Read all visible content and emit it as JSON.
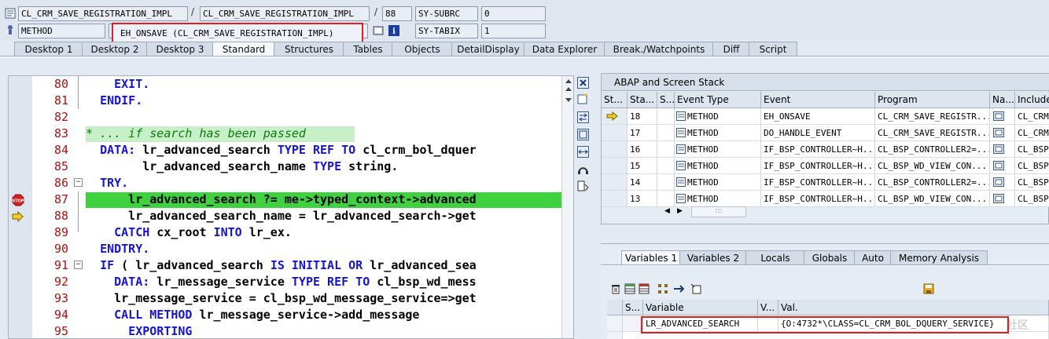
{
  "header": {
    "row1": {
      "program": "CL_CRM_SAVE_REGISTRATION_IMPL",
      "include": "CL_CRM_SAVE_REGISTRATION_IMPL",
      "line": "88",
      "sysfield_label": "SY-SUBRC",
      "sysfield_value": "0"
    },
    "row2": {
      "event_type": "METHOD",
      "event": "EH_ONSAVE (CL_CRM_SAVE_REGISTRATION_IMPL)",
      "sysfield_label": "SY-TABIX",
      "sysfield_value": "1"
    },
    "sep1": "/",
    "sep2": "/"
  },
  "tabs": [
    "Desktop 1",
    "Desktop 2",
    "Desktop 3",
    "Standard",
    "Structures",
    "Tables",
    "Objects",
    "DetailDisplay",
    "Data Explorer",
    "Break./Watchpoints",
    "Diff",
    "Script"
  ],
  "active_tab": "Standard",
  "code_lines": [
    {
      "no": "80",
      "code": "    EXIT."
    },
    {
      "no": "81",
      "code": "  ENDIF."
    },
    {
      "no": "82",
      "code": ""
    },
    {
      "no": "83",
      "code": "* ... if search has been passed"
    },
    {
      "no": "84",
      "code": "  DATA: lr_advanced_search TYPE REF TO cl_crm_bol_dquer"
    },
    {
      "no": "85",
      "code": "        lr_advanced_search_name TYPE string."
    },
    {
      "no": "86",
      "code": "  TRY."
    },
    {
      "no": "87",
      "code": "      lr_advanced_search ?= me->typed_context->advanced"
    },
    {
      "no": "88",
      "code": "      lr_advanced_search_name = lr_advanced_search->get"
    },
    {
      "no": "89",
      "code": "    CATCH cx_root INTO lr_ex."
    },
    {
      "no": "90",
      "code": "  ENDTRY."
    },
    {
      "no": "91",
      "code": "  IF ( lr_advanced_search IS INITIAL OR lr_advanced_sea"
    },
    {
      "no": "92",
      "code": "    DATA: lr_message_service TYPE REF TO cl_bsp_wd_mess"
    },
    {
      "no": "93",
      "code": "    lr_message_service = cl_bsp_wd_message_service=>get"
    },
    {
      "no": "94",
      "code": "    CALL METHOD lr_message_service->add_message"
    },
    {
      "no": "95",
      "code": "      EXPORTING"
    }
  ],
  "stack": {
    "title": "ABAP and Screen Stack",
    "columns": [
      "St...",
      "Sta...",
      "S...",
      "Event Type",
      "Event",
      "Program",
      "Na...",
      "Include"
    ],
    "rows": [
      {
        "level": "18",
        "type": "METHOD",
        "event": "EH_ONSAVE",
        "program": "CL_CRM_SAVE_REGISTR...",
        "include": "CL_CRM"
      },
      {
        "level": "17",
        "type": "METHOD",
        "event": "DO_HANDLE_EVENT",
        "program": "CL_CRM_SAVE_REGISTR...",
        "include": "CL_CRM"
      },
      {
        "level": "16",
        "type": "METHOD",
        "event": "IF_BSP_CONTROLLER~H...",
        "program": "CL_BSP_CONTROLLER2=...",
        "include": "CL_BSP_"
      },
      {
        "level": "15",
        "type": "METHOD",
        "event": "IF_BSP_CONTROLLER~H...",
        "program": "CL_BSP_WD_VIEW_CON...",
        "include": "CL_BSP_"
      },
      {
        "level": "14",
        "type": "METHOD",
        "event": "IF_BSP_CONTROLLER~H...",
        "program": "CL_BSP_CONTROLLER2=...",
        "include": "CL_BSP_"
      },
      {
        "level": "13",
        "type": "METHOD",
        "event": "IF_BSP_CONTROLLER~H...",
        "program": "CL_BSP_WD_VIEW_CON...",
        "include": "CL_BSP_"
      }
    ],
    "scroll_mid": ":::"
  },
  "variables": {
    "tabs": [
      "Variables 1",
      "Variables 2",
      "Locals",
      "Globals",
      "Auto",
      "Memory Analysis"
    ],
    "active_tab": "Variables 1",
    "columns": [
      "S...",
      "Variable",
      "V...",
      "Val."
    ],
    "rows": [
      {
        "variable": "LR_ADVANCED_SEARCH",
        "value": "{O:4732*\\CLASS=CL_CRM_BOL_DQUERY_SERVICE}"
      }
    ],
    "watermark": "社区"
  },
  "colors": {
    "current_line": "#3fd13f",
    "comment_bg": "#c8f0c8",
    "keyword": "#1515d0",
    "line_number": "#b01010",
    "highlight_box": "#e02020"
  }
}
